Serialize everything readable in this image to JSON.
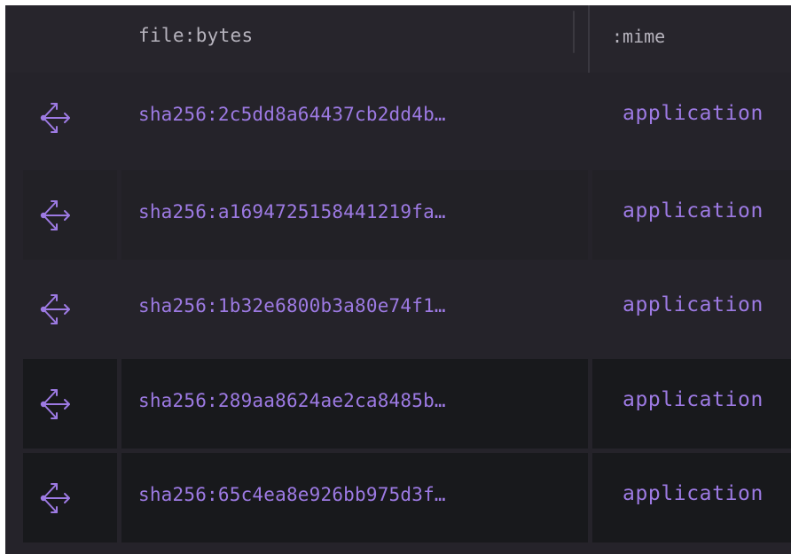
{
  "table": {
    "columns": {
      "bytes_label": "file:bytes",
      "mime_label": ":mime"
    },
    "rows": [
      {
        "icon": "share-icon",
        "hash": "sha256:2c5dd8a64437cb2dd4b…",
        "mime": "application"
      },
      {
        "icon": "share-icon",
        "hash": "sha256:a1694725158441219fa…",
        "mime": "application"
      },
      {
        "icon": "share-icon",
        "hash": "sha256:1b32e6800b3a80e74f1…",
        "mime": "application"
      },
      {
        "icon": "share-icon",
        "hash": "sha256:289aa8624ae2ca8485b…",
        "mime": "application"
      },
      {
        "icon": "share-icon",
        "hash": "sha256:65c4ea8e926bb975d3f…",
        "mime": "application"
      }
    ]
  },
  "colors": {
    "background": "#25232a",
    "accent_text": "#9d7ae3",
    "header_text": "#b6b3bd",
    "band_row": "#222126",
    "dark_row": "#18191c"
  }
}
